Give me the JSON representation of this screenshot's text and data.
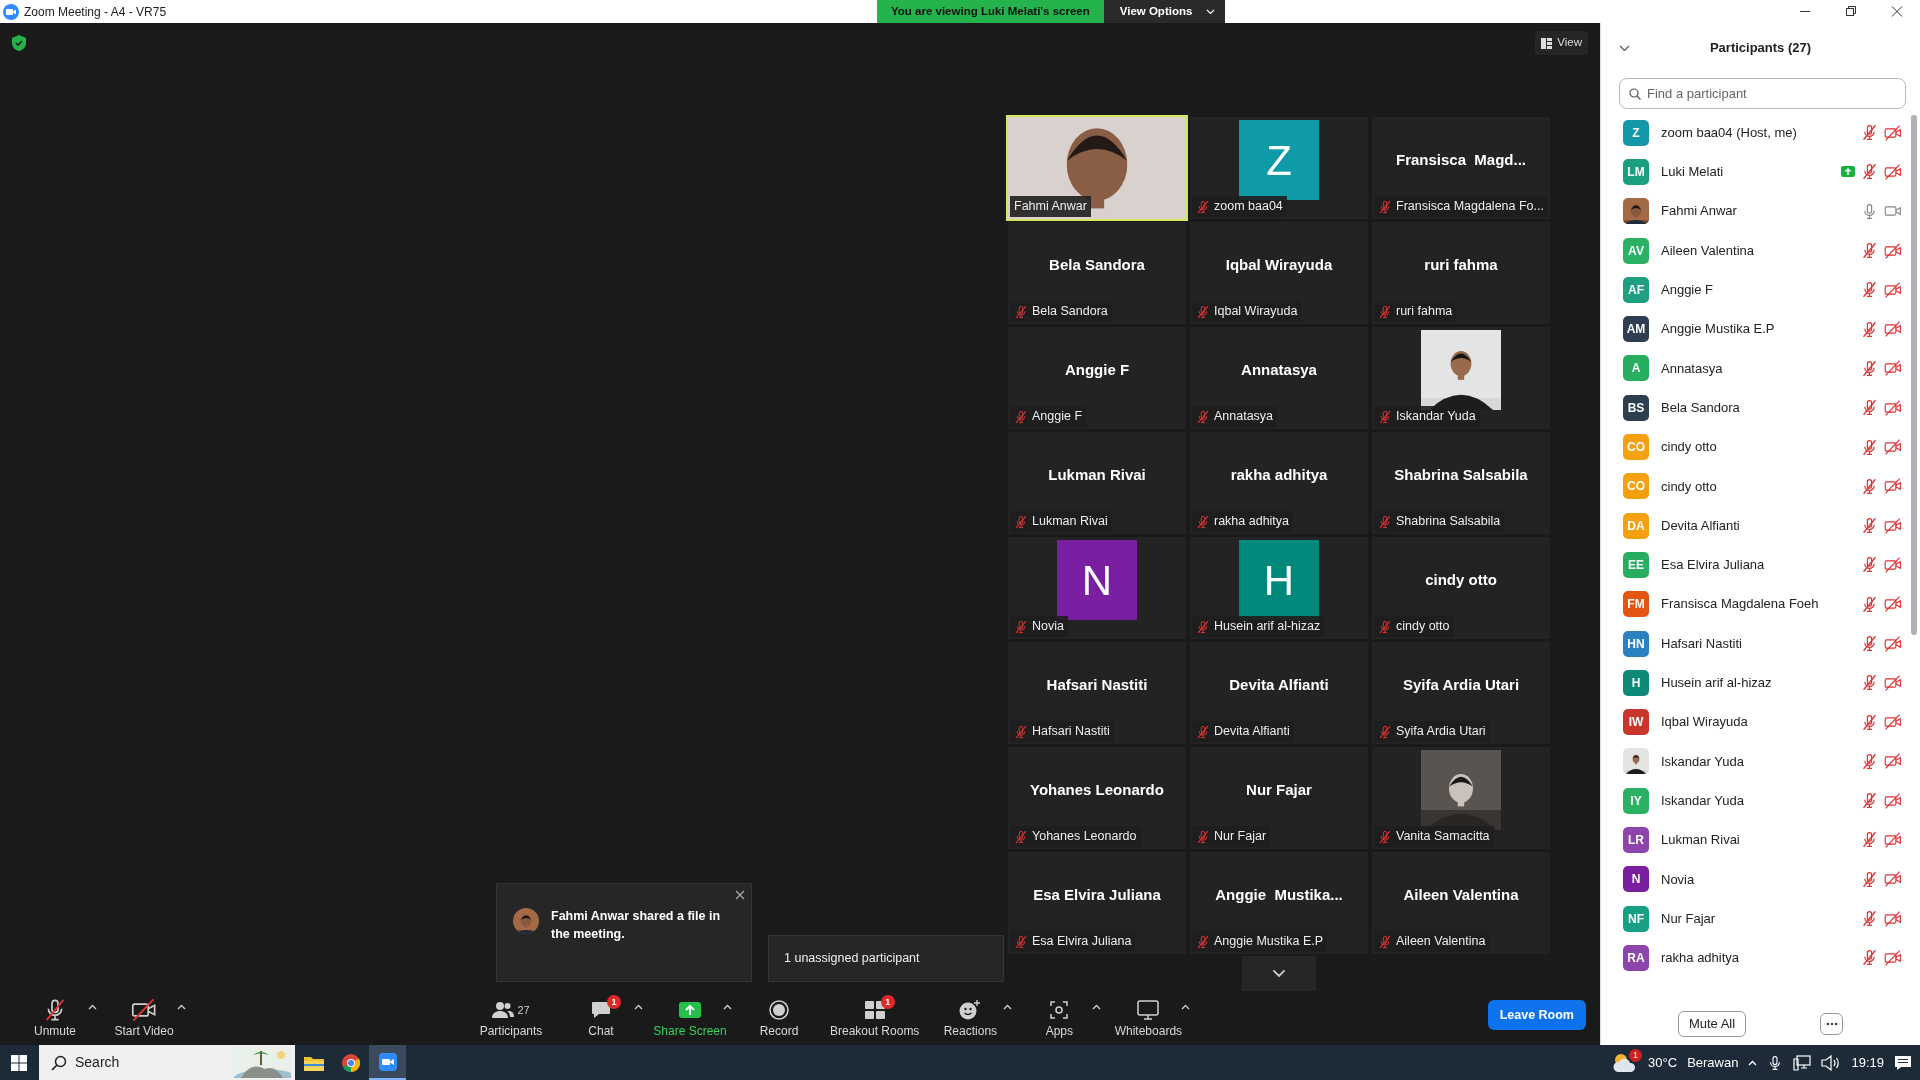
{
  "window": {
    "title": "Zoom Meeting - A4 - VR75"
  },
  "share_banner": {
    "text": "You are viewing Luki Melati's screen",
    "button": "View Options"
  },
  "view_button": "View",
  "tiles": [
    {
      "kind": "video",
      "label": "Fahmi Anwar",
      "muted": false,
      "speaking": true
    },
    {
      "kind": "avatar",
      "initial": "Z",
      "color": "#0e9aa7",
      "label": "zoom baa04",
      "muted": true,
      "speaking": false
    },
    {
      "kind": "name",
      "title": "Fransisca  Magd...",
      "label": "Fransisca Magdalena Fo...",
      "muted": true,
      "speaking": false
    },
    {
      "kind": "name",
      "title": "Bela Sandora",
      "label": "Bela Sandora",
      "muted": true,
      "speaking": false
    },
    {
      "kind": "name",
      "title": "Iqbal Wirayuda",
      "label": "Iqbal Wirayuda",
      "muted": true,
      "speaking": false
    },
    {
      "kind": "name",
      "title": "ruri fahma",
      "label": "ruri fahma",
      "muted": true,
      "speaking": false
    },
    {
      "kind": "name",
      "title": "Anggie F",
      "label": "Anggie F",
      "muted": true,
      "speaking": false
    },
    {
      "kind": "name",
      "title": "Annatasya",
      "label": "Annatasya",
      "muted": true,
      "speaking": false
    },
    {
      "label": "Iskandar Yuda",
      "muted": true,
      "speaking": false
    },
    {
      "kind": "name",
      "title": "Lukman Rivai",
      "label": "Lukman Rivai",
      "muted": true,
      "speaking": false
    },
    {
      "kind": "name",
      "title": "rakha adhitya",
      "label": "rakha adhitya",
      "muted": true,
      "speaking": false
    },
    {
      "kind": "name",
      "title": "Shabrina Salsabila",
      "label": "Shabrina Salsabila",
      "muted": true,
      "speaking": false
    },
    {
      "kind": "avatar",
      "initial": "N",
      "color": "#7b1fa2",
      "label": "Novia",
      "muted": true,
      "speaking": false
    },
    {
      "kind": "avatar",
      "initial": "H",
      "color": "#00897b",
      "label": "Husein arif al-hizaz",
      "muted": true,
      "speaking": false
    },
    {
      "kind": "name",
      "title": "cindy otto",
      "label": "cindy otto",
      "muted": true,
      "speaking": false
    },
    {
      "kind": "name",
      "title": "Hafsari Nastiti",
      "label": "Hafsari Nastiti",
      "muted": true,
      "speaking": false
    },
    {
      "kind": "name",
      "title": "Devita Alfianti",
      "label": "Devita Alfianti",
      "muted": true,
      "speaking": false
    },
    {
      "kind": "name",
      "title": "Syifa Ardia Utari",
      "label": "Syifa Ardia Utari",
      "muted": true,
      "speaking": false
    },
    {
      "kind": "name",
      "title": "Yohanes Leonardo",
      "label": "Yohanes Leonardo",
      "muted": true,
      "speaking": false
    },
    {
      "kind": "name",
      "title": "Nur Fajar",
      "label": "Nur Fajar",
      "muted": true,
      "speaking": false
    },
    {
      "label": "Vanita Samacitta",
      "muted": true,
      "speaking": false
    },
    {
      "kind": "name",
      "title": "Esa Elvira Juliana",
      "label": "Esa Elvira Juliana",
      "muted": true,
      "speaking": false
    },
    {
      "kind": "name",
      "title": "Anggie  Mustika...",
      "label": "Anggie Mustika E.P",
      "muted": true,
      "speaking": false
    },
    {
      "kind": "name",
      "title": "Aileen Valentina",
      "label": "Aileen Valentina",
      "muted": true,
      "speaking": false
    }
  ],
  "notification": {
    "text": "Fahmi Anwar shared a file in the meeting."
  },
  "tooltip": "1 unassigned participant",
  "toolbar": [
    {
      "kind": "mic",
      "label": "Unmute",
      "menu": true
    },
    {
      "kind": "video",
      "label": "Start Video",
      "menu": true
    },
    {
      "kind": "participants",
      "label": "Participants",
      "count": "27",
      "menu": false
    },
    {
      "kind": "chat",
      "label": "Chat",
      "badge": "1",
      "menu": true
    },
    {
      "kind": "share",
      "label": "Share Screen",
      "menu": true
    },
    {
      "kind": "record",
      "label": "Record",
      "menu": false
    },
    {
      "kind": "breakout",
      "label": "Breakout Rooms",
      "badge": "1",
      "menu": false
    },
    {
      "kind": "reactions",
      "label": "Reactions",
      "menu": true
    },
    {
      "kind": "apps",
      "label": "Apps",
      "menu": true
    },
    {
      "kind": "whiteboard",
      "label": "Whiteboards",
      "menu": true
    }
  ],
  "leave_button": "Leave Room",
  "panel": {
    "title": "Participants (27)",
    "search_placeholder": "Find a participant",
    "footer_button": "Mute All",
    "participants": [
      {
        "name": "zoom baa04 (Host, me)",
        "kind": "initials",
        "initials": "Z",
        "color": "#1497a8",
        "muted": true,
        "video_off": true,
        "sharing": false
      },
      {
        "name": "Luki Melati",
        "kind": "initials",
        "initials": "LM",
        "color": "#1c9e80",
        "muted": true,
        "video_off": true,
        "sharing": true
      },
      {
        "name": "Fahmi Anwar",
        "muted": false,
        "video_off": false,
        "sharing": false
      },
      {
        "name": "Aileen Valentina",
        "kind": "initials",
        "initials": "AV",
        "color": "#2bb163",
        "muted": true,
        "video_off": true,
        "sharing": false
      },
      {
        "name": "Anggie F",
        "kind": "initials",
        "initials": "AF",
        "color": "#1f9f82",
        "muted": true,
        "video_off": true,
        "sharing": false
      },
      {
        "name": "Anggie Mustika E.P",
        "kind": "initials",
        "initials": "AM",
        "color": "#2f3e52",
        "muted": true,
        "video_off": true,
        "sharing": false
      },
      {
        "name": "Annatasya",
        "kind": "initials",
        "initials": "A",
        "color": "#27ae60",
        "muted": true,
        "video_off": true,
        "sharing": false
      },
      {
        "name": "Bela Sandora",
        "kind": "initials",
        "initials": "BS",
        "color": "#2c3e50",
        "muted": true,
        "video_off": true,
        "sharing": false
      },
      {
        "name": "cindy otto",
        "kind": "initials",
        "initials": "CO",
        "color": "#f5a00f",
        "muted": true,
        "video_off": true,
        "sharing": false
      },
      {
        "name": "cindy otto",
        "kind": "initials",
        "initials": "CO",
        "color": "#f5a00f",
        "muted": true,
        "video_off": true,
        "sharing": false
      },
      {
        "name": "Devita Alfianti",
        "kind": "initials",
        "initials": "DA",
        "color": "#f5a00f",
        "muted": true,
        "video_off": true,
        "sharing": false
      },
      {
        "name": "Esa Elvira Juliana",
        "kind": "initials",
        "initials": "EE",
        "color": "#27ae60",
        "muted": true,
        "video_off": true,
        "sharing": false
      },
      {
        "name": "Fransisca Magdalena Foeh",
        "kind": "initials",
        "initials": "FM",
        "color": "#e25612",
        "muted": true,
        "video_off": true,
        "sharing": false
      },
      {
        "name": "Hafsari Nastiti",
        "kind": "initials",
        "initials": "HN",
        "color": "#2a80c0",
        "muted": true,
        "video_off": true,
        "sharing": false
      },
      {
        "name": "Husein arif al-hizaz",
        "kind": "initials",
        "initials": "H",
        "color": "#0e8a78",
        "muted": true,
        "video_off": true,
        "sharing": false
      },
      {
        "name": "Iqbal Wirayuda",
        "kind": "initials",
        "initials": "IW",
        "color": "#c9362b",
        "muted": true,
        "video_off": true,
        "sharing": false
      },
      {
        "name": "Iskandar Yuda",
        "muted": true,
        "video_off": true,
        "sharing": false
      },
      {
        "name": "Iskandar Yuda",
        "kind": "initials",
        "initials": "IY",
        "color": "#2bb163",
        "muted": true,
        "video_off": true,
        "sharing": false
      },
      {
        "name": "Lukman Rivai",
        "kind": "initials",
        "initials": "LR",
        "color": "#8e44ad",
        "muted": true,
        "video_off": true,
        "sharing": false
      },
      {
        "name": "Novia",
        "kind": "initials",
        "initials": "N",
        "color": "#7b1fa2",
        "muted": true,
        "video_off": true,
        "sharing": false
      },
      {
        "name": "Nur Fajar",
        "kind": "initials",
        "initials": "NF",
        "color": "#16a085",
        "muted": true,
        "video_off": true,
        "sharing": false
      },
      {
        "name": "rakha adhitya",
        "kind": "initials",
        "initials": "RA",
        "color": "#8e44ad",
        "muted": true,
        "video_off": true,
        "sharing": false
      }
    ]
  },
  "taskbar": {
    "search": "Search",
    "weather_badge": "1",
    "temperature": "30°C",
    "condition": "Berawan",
    "time": "19:19",
    "apps": [
      {
        "kind": "folder",
        "active": false
      },
      {
        "kind": "browser",
        "active": false
      },
      {
        "kind": "video",
        "active": true
      }
    ]
  }
}
